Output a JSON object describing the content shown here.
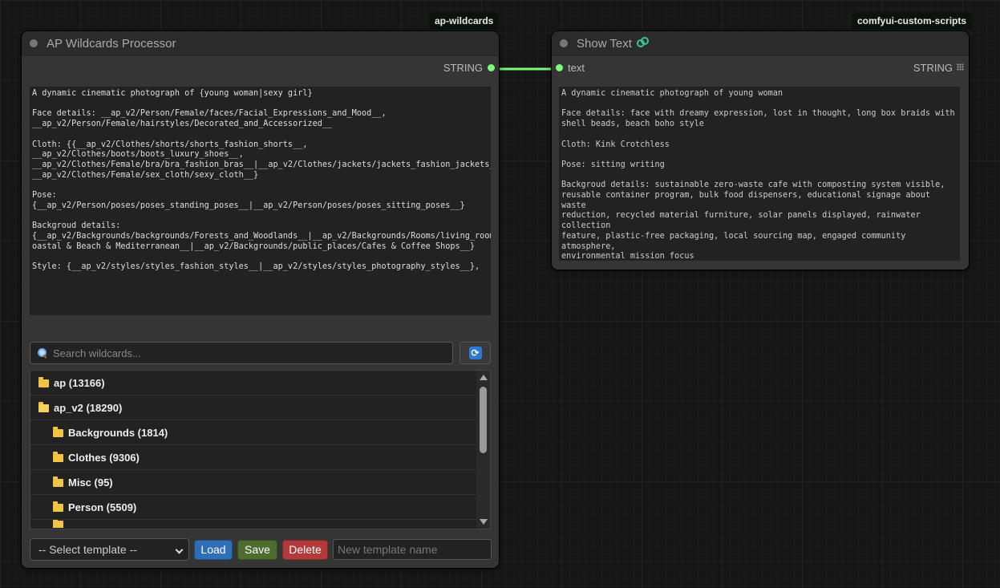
{
  "badges": {
    "left": "ap-wildcards",
    "right": "comfyui-custom-scripts"
  },
  "colors": {
    "canvas_bg": "#161616",
    "node_bg": "#353535",
    "link": "#7ef97e",
    "load_btn": "#2f6fb7",
    "save_btn": "#4c6d2d",
    "delete_btn": "#b23a3a"
  },
  "left_node": {
    "title": "AP Wildcards Processor",
    "output_type": "STRING",
    "prompt_text": "A dynamic cinematic photograph of {young woman|sexy girl}\n\nFace details: __ap_v2/Person/Female/faces/Facial_Expressions_and_Mood__,\n__ap_v2/Person/Female/hairstyles/Decorated_and_Accessorized__\n\nCloth: {{__ap_v2/Clothes/shorts/shorts_fashion_shorts__,\n__ap_v2/Clothes/boots/boots_luxury_shoes__,\n__ap_v2/Clothes/Female/bra/bra_fashion_bras__|__ap_v2/Clothes/jackets/jackets_fashion_jackets__}|\n__ap_v2/Clothes/Female/sex_cloth/sexy_cloth__}\n\nPose: {__ap_v2/Person/poses/poses_standing_poses__|__ap_v2/Person/poses/poses_sitting_poses__}\n\nBackgroud details:\n{__ap_v2/Backgrounds/backgrounds/Forests_and_Woodlands__|__ap_v2/Backgrounds/Rooms/living_rooms/C\noastal & Beach & Mediterranean__|__ap_v2/Backgrounds/public_places/Cafes & Coffee Shops__}\n\nStyle: {__ap_v2/styles/styles_fashion_styles__|__ap_v2/styles/styles_photography_styles__},",
    "search_placeholder": "Search wildcards...",
    "tree": [
      {
        "label": "ap (13166)",
        "level": 0,
        "open": false
      },
      {
        "label": "ap_v2 (18290)",
        "level": 0,
        "open": true
      },
      {
        "label": "Backgrounds (1814)",
        "level": 1,
        "open": false
      },
      {
        "label": "Clothes (9306)",
        "level": 1,
        "open": false
      },
      {
        "label": "Misc (95)",
        "level": 1,
        "open": false
      },
      {
        "label": "Person (5509)",
        "level": 1,
        "open": false
      }
    ],
    "select_template": "-- Select template --",
    "load_label": "Load",
    "save_label": "Save",
    "delete_label": "Delete",
    "new_template_placeholder": "New template name"
  },
  "right_node": {
    "title": "Show Text",
    "input_label": "text",
    "output_type": "STRING",
    "output_text": "A dynamic cinematic photograph of young woman\n\nFace details: face with dreamy expression, lost in thought, long box braids with\nshell beads, beach boho style\n\nCloth: Kink Crotchless\n\nPose: sitting writing\n\nBackgroud details: sustainable zero-waste cafe with composting system visible,\nreusable container program, bulk food dispensers, educational signage about waste\nreduction, recycled material furniture, solar panels displayed, rainwater collection\nfeature, plastic-free packaging, local sourcing map, engaged community atmosphere,\nenvironmental mission focus\n\nStyle: hip hop fashion,"
  }
}
